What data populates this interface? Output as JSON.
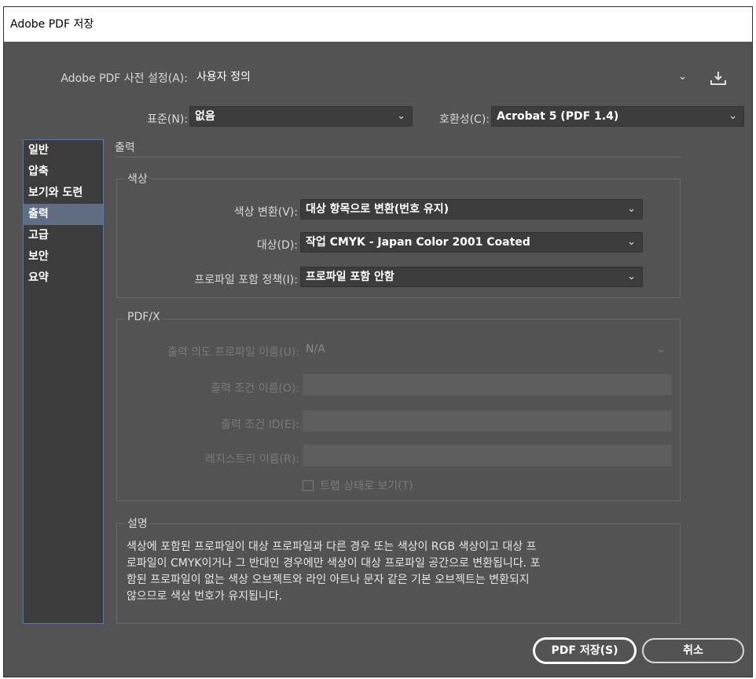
{
  "window": {
    "title": "Adobe PDF 저장"
  },
  "preset": {
    "label": "Adobe PDF 사전 설정(A):",
    "value": "사용자 정의",
    "save_icon": "download-icon"
  },
  "standard": {
    "label": "표준(N):",
    "value": "없음"
  },
  "compatibility": {
    "label": "호환성(C):",
    "value": "Acrobat 5 (PDF 1.4)"
  },
  "sidebar": {
    "items": [
      {
        "label": "일반"
      },
      {
        "label": "압축"
      },
      {
        "label": "보기와 도련"
      },
      {
        "label": "출력"
      },
      {
        "label": "고급"
      },
      {
        "label": "보안"
      },
      {
        "label": "요약"
      }
    ],
    "active_index": 3
  },
  "panel": {
    "title": "출력"
  },
  "color": {
    "title": "색상",
    "conversion_label": "색상 변환(V):",
    "conversion_value": "대상 항목으로 변환(번호 유지)",
    "destination_label": "대상(D):",
    "destination_value": "작업 CMYK - Japan Color 2001 Coated",
    "profile_policy_label": "프로파일 포함 정책(I):",
    "profile_policy_value": "프로파일 포함 안함"
  },
  "pdfx": {
    "title": "PDF/X",
    "intent_profile_label": "출력 의도 프로파일 이름(U):",
    "intent_profile_value": "N/A",
    "condition_name_label": "출력 조건 이름(O):",
    "condition_id_label": "출력 조건 ID(E):",
    "registry_label": "레지스트리 이름(R):",
    "trapped_label": "트랩 상태로 보기(T)"
  },
  "description": {
    "title": "설명",
    "lines": [
      "색상에 포함된 프로파일이 대상 프로파일과 다른 경우 또는 색상이 RGB 색상이고 대상 프",
      "로파일이 CMYK이거나 그 반대인 경우에만 색상이 대상 프로파일 공간으로 변환됩니다. 포",
      "함된 프로파일이 없는 색상 오브젝트와 라인 아트나 문자 같은 기본 오브젝트는 변환되지",
      "않으므로 색상 번호가 유지됩니다."
    ]
  },
  "buttons": {
    "save": "PDF 저장(S)",
    "cancel": "취소"
  }
}
